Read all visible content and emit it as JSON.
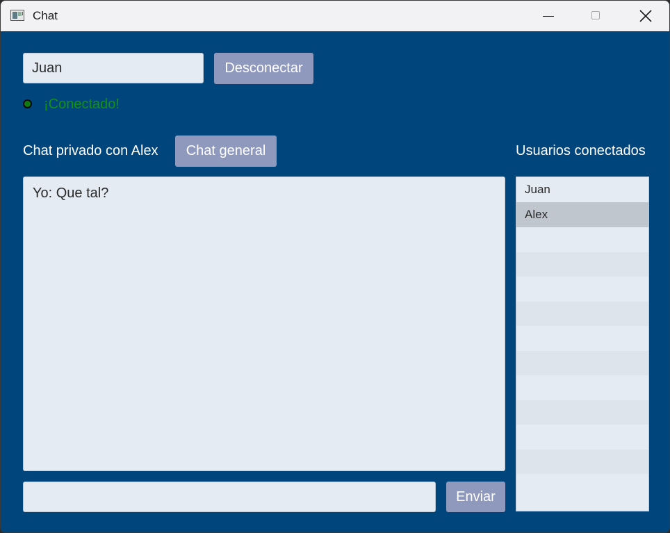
{
  "window": {
    "title": "Chat",
    "icon": "app-window-icon"
  },
  "controls": {
    "minimize_icon": "minimize-icon",
    "maximize_icon": "maximize-icon",
    "close_icon": "close-icon"
  },
  "connection": {
    "username_value": "Juan",
    "disconnect_label": "Desconectar",
    "status_text": "¡Conectado!",
    "status_color": "#129312"
  },
  "chat": {
    "private_label": "Chat privado con Alex",
    "general_button_label": "Chat general",
    "messages": [
      "Yo: Que tal?"
    ],
    "message_input_value": "",
    "send_label": "Enviar"
  },
  "users": {
    "header": "Usuarios conectados",
    "items": [
      "Juan",
      "Alex"
    ],
    "selected_index": 1
  },
  "colors": {
    "background": "#00457c",
    "button": "#8f98bd",
    "field": "#e4ebf3",
    "selected_row": "#c0c6ce"
  }
}
